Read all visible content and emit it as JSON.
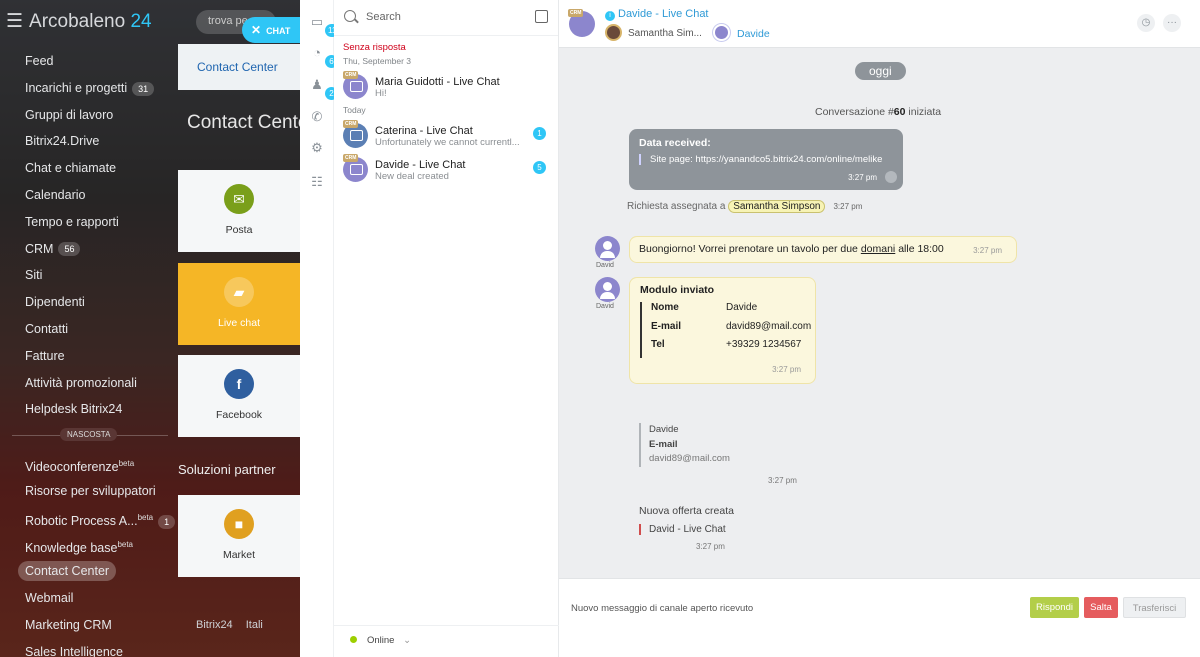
{
  "portal": {
    "logo_name": "Arcobaleno",
    "logo_num": "24",
    "search_placeholder": "trova pe",
    "menu": [
      {
        "label": "Feed"
      },
      {
        "label": "Incarichi e progetti",
        "count": "31"
      },
      {
        "label": "Gruppi di lavoro"
      },
      {
        "label": "Bitrix24.Drive"
      },
      {
        "label": "Chat e chiamate"
      },
      {
        "label": "Calendario"
      },
      {
        "label": "Tempo e rapporti"
      },
      {
        "label": "CRM",
        "count": "56"
      },
      {
        "label": "Siti"
      },
      {
        "label": "Dipendenti"
      },
      {
        "label": "Contatti"
      },
      {
        "label": "Fatture"
      },
      {
        "label": "Attività promozionali"
      },
      {
        "label": "Helpdesk Bitrix24"
      }
    ],
    "hidden_label": "NASCOSTA",
    "hidden_menu": [
      {
        "label": "Videoconferenze",
        "sup": "beta"
      },
      {
        "label": "Risorse per sviluppatori"
      },
      {
        "label": "Robotic Process A...",
        "sup": "beta",
        "count": "1"
      },
      {
        "label": "Knowledge base",
        "sup": "beta"
      },
      {
        "label": "Contact Center"
      },
      {
        "label": "Webmail"
      },
      {
        "label": "Marketing CRM"
      },
      {
        "label": "Sales Intelligence"
      }
    ],
    "cc_tab": "Contact Center",
    "cc_title": "Contact Center",
    "tiles": [
      {
        "label": "Posta",
        "color": "#7a9f1a"
      },
      {
        "label": "Live chat",
        "color": "#f5b626"
      },
      {
        "label": "Facebook",
        "color": "#2f5f9f"
      },
      {
        "label": "Market",
        "color": "#e0a020"
      }
    ],
    "partner_label": "Soluzioni partner",
    "bottom_logo": "Bitrix24",
    "bottom_lang": "Itali"
  },
  "chat_toggle": "CHAT",
  "iconbar": {
    "badges": [
      "11",
      "6",
      "2"
    ]
  },
  "recent": {
    "search_placeholder": "Search",
    "section_unanswered": "Senza risposta",
    "date1": "Thu, September 3",
    "date2": "Today",
    "items": [
      {
        "title": "Maria Guidotti - Live Chat",
        "sub": "Hi!",
        "badge": ""
      },
      {
        "title": "Caterina - Live Chat",
        "sub": "Unfortunately we cannot currentl...",
        "badge": "1"
      },
      {
        "title": "Davide - Live Chat",
        "sub": "New deal created",
        "badge": "5"
      }
    ],
    "status": "Online",
    "crm_tag": "CRM"
  },
  "dialog": {
    "title": "Davide - Live Chat",
    "user1": "Samantha Sim...",
    "user2": "Davide",
    "today_label": "oggi",
    "conv_started_pre": "Conversazione #",
    "conv_number": "60",
    "conv_started_post": " iniziata",
    "data_received_title": "Data received:",
    "data_received_line": "Site page: https://yanandco5.bitrix24.com/online/melike",
    "data_received_time": "3:27 pm",
    "assigned_text": "Richiesta assegnata a",
    "assigned_to": "Samantha Simpson",
    "assigned_time": "3:27 pm",
    "author": "David",
    "msg1_pre": "Buongiorno! Vorrei prenotare un tavolo per due ",
    "msg1_link": "domani",
    "msg1_post": " alle 18:00",
    "msg1_time": "3:27 pm",
    "form_title": "Modulo inviato",
    "form_rows": [
      {
        "key": "Nome",
        "value": "Davide"
      },
      {
        "key": "E-mail",
        "value": "david89@mail.com"
      },
      {
        "key": "Tel",
        "value": "+39329 1234567"
      }
    ],
    "form_time": "3:27 pm",
    "quote_name": "Davide",
    "quote_key": "E-mail",
    "quote_email": "david89@mail.com",
    "quote_time": "3:27 pm",
    "deal_title": "Nuova offerta creata",
    "deal_name": "David - Live Chat",
    "deal_time": "3:27 pm",
    "footer_text": "Nuovo messaggio di canale aperto ricevuto",
    "btn_reply": "Rispondi",
    "btn_skip": "Salta",
    "btn_transfer": "Trasferisci"
  }
}
